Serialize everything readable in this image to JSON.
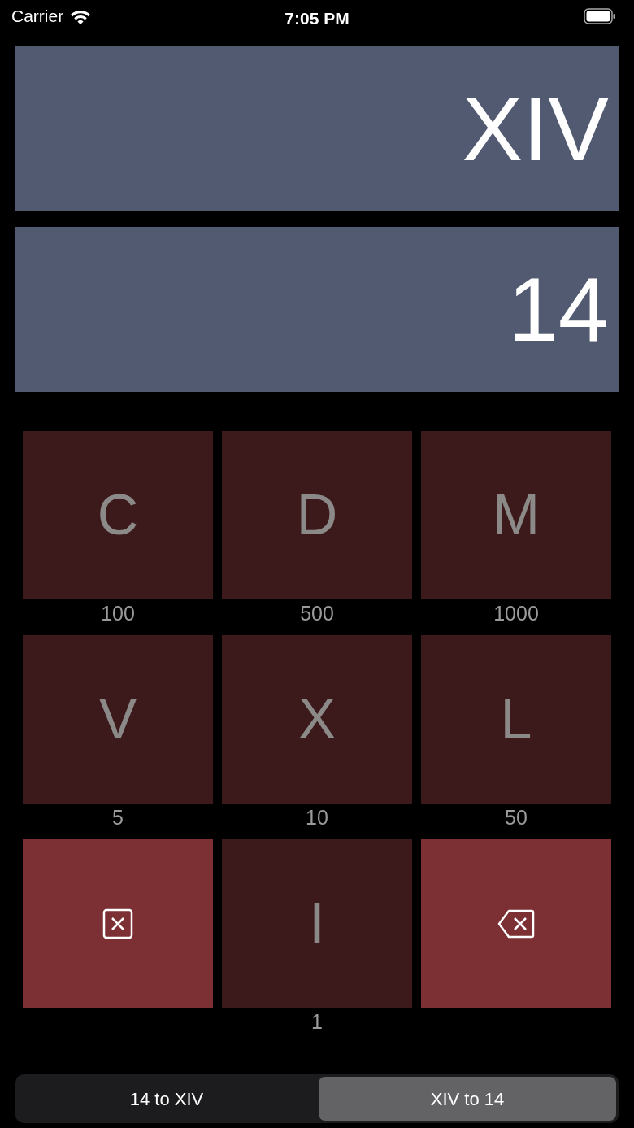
{
  "status_bar": {
    "carrier": "Carrier",
    "time": "7:05 PM"
  },
  "displays": [
    {
      "text": "XIV"
    },
    {
      "text": "14"
    }
  ],
  "keys": [
    {
      "kind": "numeral",
      "label": "C",
      "value": "100"
    },
    {
      "kind": "numeral",
      "label": "D",
      "value": "500"
    },
    {
      "kind": "numeral",
      "label": "M",
      "value": "1000"
    },
    {
      "kind": "numeral",
      "label": "V",
      "value": "5"
    },
    {
      "kind": "numeral",
      "label": "X",
      "value": "10"
    },
    {
      "kind": "numeral",
      "label": "L",
      "value": "50"
    },
    {
      "kind": "clear"
    },
    {
      "kind": "numeral",
      "label": "I",
      "value": "1"
    },
    {
      "kind": "backspace"
    }
  ],
  "segments": [
    {
      "label": "14 to XIV",
      "selected": false
    },
    {
      "label": "XIV to 14",
      "selected": true
    }
  ]
}
